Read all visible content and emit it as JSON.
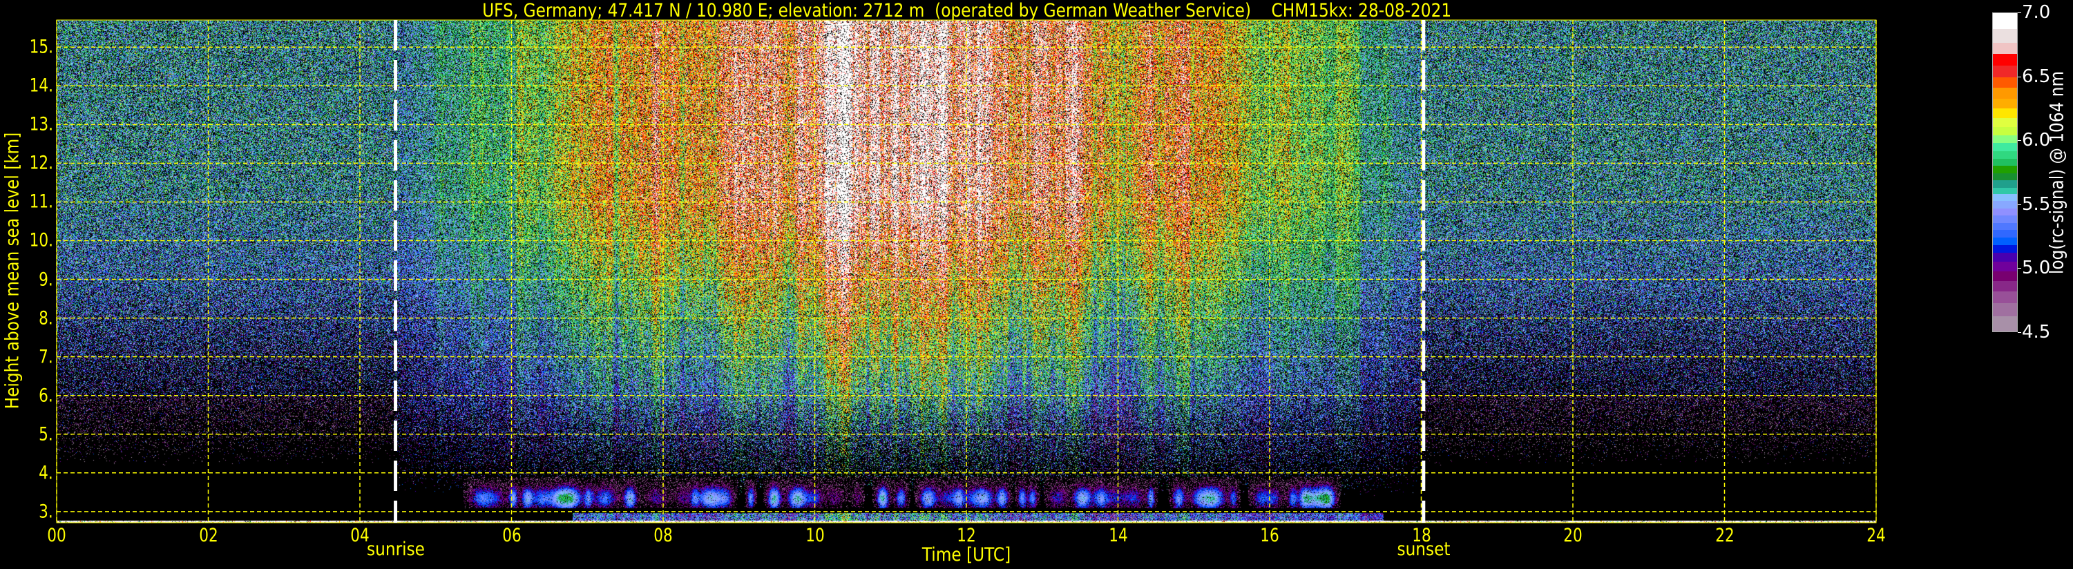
{
  "chart_data": {
    "type": "heatmap",
    "title": "UFS, Germany; 47.417 N / 10.980 E; elevation: 2712 m  (operated by German Weather Service)    CHM15kx: 28-08-2021",
    "xlabel": "Time [UTC]",
    "ylabel": "Height above mean sea level [km]",
    "xlim": [
      0,
      24
    ],
    "ylim": [
      2.712,
      15.7
    ],
    "x_ticks": [
      "00",
      "02",
      "04",
      "06",
      "08",
      "10",
      "12",
      "14",
      "16",
      "18",
      "20",
      "22",
      "24"
    ],
    "y_ticks": [
      "3.",
      "4.",
      "5.",
      "6.",
      "7.",
      "8.",
      "9.",
      "10.",
      "11.",
      "12.",
      "13.",
      "14.",
      "15."
    ],
    "grid": true,
    "grid_color": "#ffff00",
    "events": [
      {
        "label": "sunrise",
        "time": 4.47
      },
      {
        "label": "sunset",
        "time": 18.03
      }
    ],
    "colorbar": {
      "label": "log(rc-signal) @ 1064 nm",
      "range": [
        4.5,
        7.0
      ],
      "ticks": [
        "7.0",
        "6.5",
        "6.0",
        "5.5",
        "5.0",
        "4.5"
      ],
      "colors": [
        "#ffffff",
        "#ebe0e0",
        "#f0c4c4",
        "#ff0000",
        "#f02828",
        "#ff5a00",
        "#ff9900",
        "#ffad00",
        "#ffe600",
        "#e0ff40",
        "#c8ff40",
        "#88ff80",
        "#40eaa0",
        "#30d880",
        "#20c060",
        "#20a000",
        "#189030",
        "#20a08c",
        "#30c8a8",
        "#88c0ff",
        "#88a8ff",
        "#9090ff",
        "#7088ff",
        "#5078ff",
        "#3068ff",
        "#0060ff",
        "#0018e0",
        "#4800b0",
        "#70009c",
        "#780070",
        "#882888",
        "#985098",
        "#a070a0",
        "#a890a8"
      ]
    },
    "features": {
      "ground_elevation_km": 2.712,
      "boundary_layer_clouds": {
        "time_range": [
          5.6,
          16.8
        ],
        "height_range_km": [
          3.1,
          3.9
        ]
      }
    }
  }
}
